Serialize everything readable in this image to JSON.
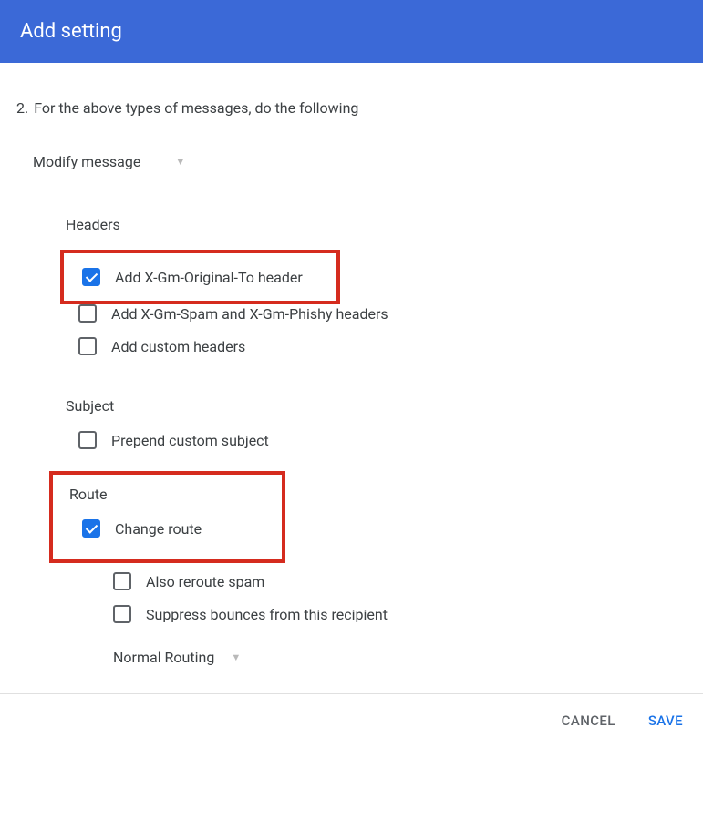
{
  "title": "Add setting",
  "step": {
    "num": "2.",
    "text": "For the above types of messages, do the following"
  },
  "action_dropdown": "Modify message",
  "headers": {
    "label": "Headers",
    "opts": [
      {
        "label": "Add X-Gm-Original-To header",
        "checked": true
      },
      {
        "label": "Add X-Gm-Spam and X-Gm-Phishy headers",
        "checked": false
      },
      {
        "label": "Add custom headers",
        "checked": false
      }
    ]
  },
  "subject": {
    "label": "Subject",
    "opts": [
      {
        "label": "Prepend custom subject",
        "checked": false
      }
    ]
  },
  "route": {
    "label": "Route",
    "change": {
      "label": "Change route",
      "checked": true
    },
    "subs": [
      {
        "label": "Also reroute spam",
        "checked": false
      },
      {
        "label": "Suppress bounces from this recipient",
        "checked": false
      }
    ],
    "routing_dropdown": "Normal Routing"
  },
  "footer": {
    "cancel": "CANCEL",
    "save": "SAVE"
  }
}
